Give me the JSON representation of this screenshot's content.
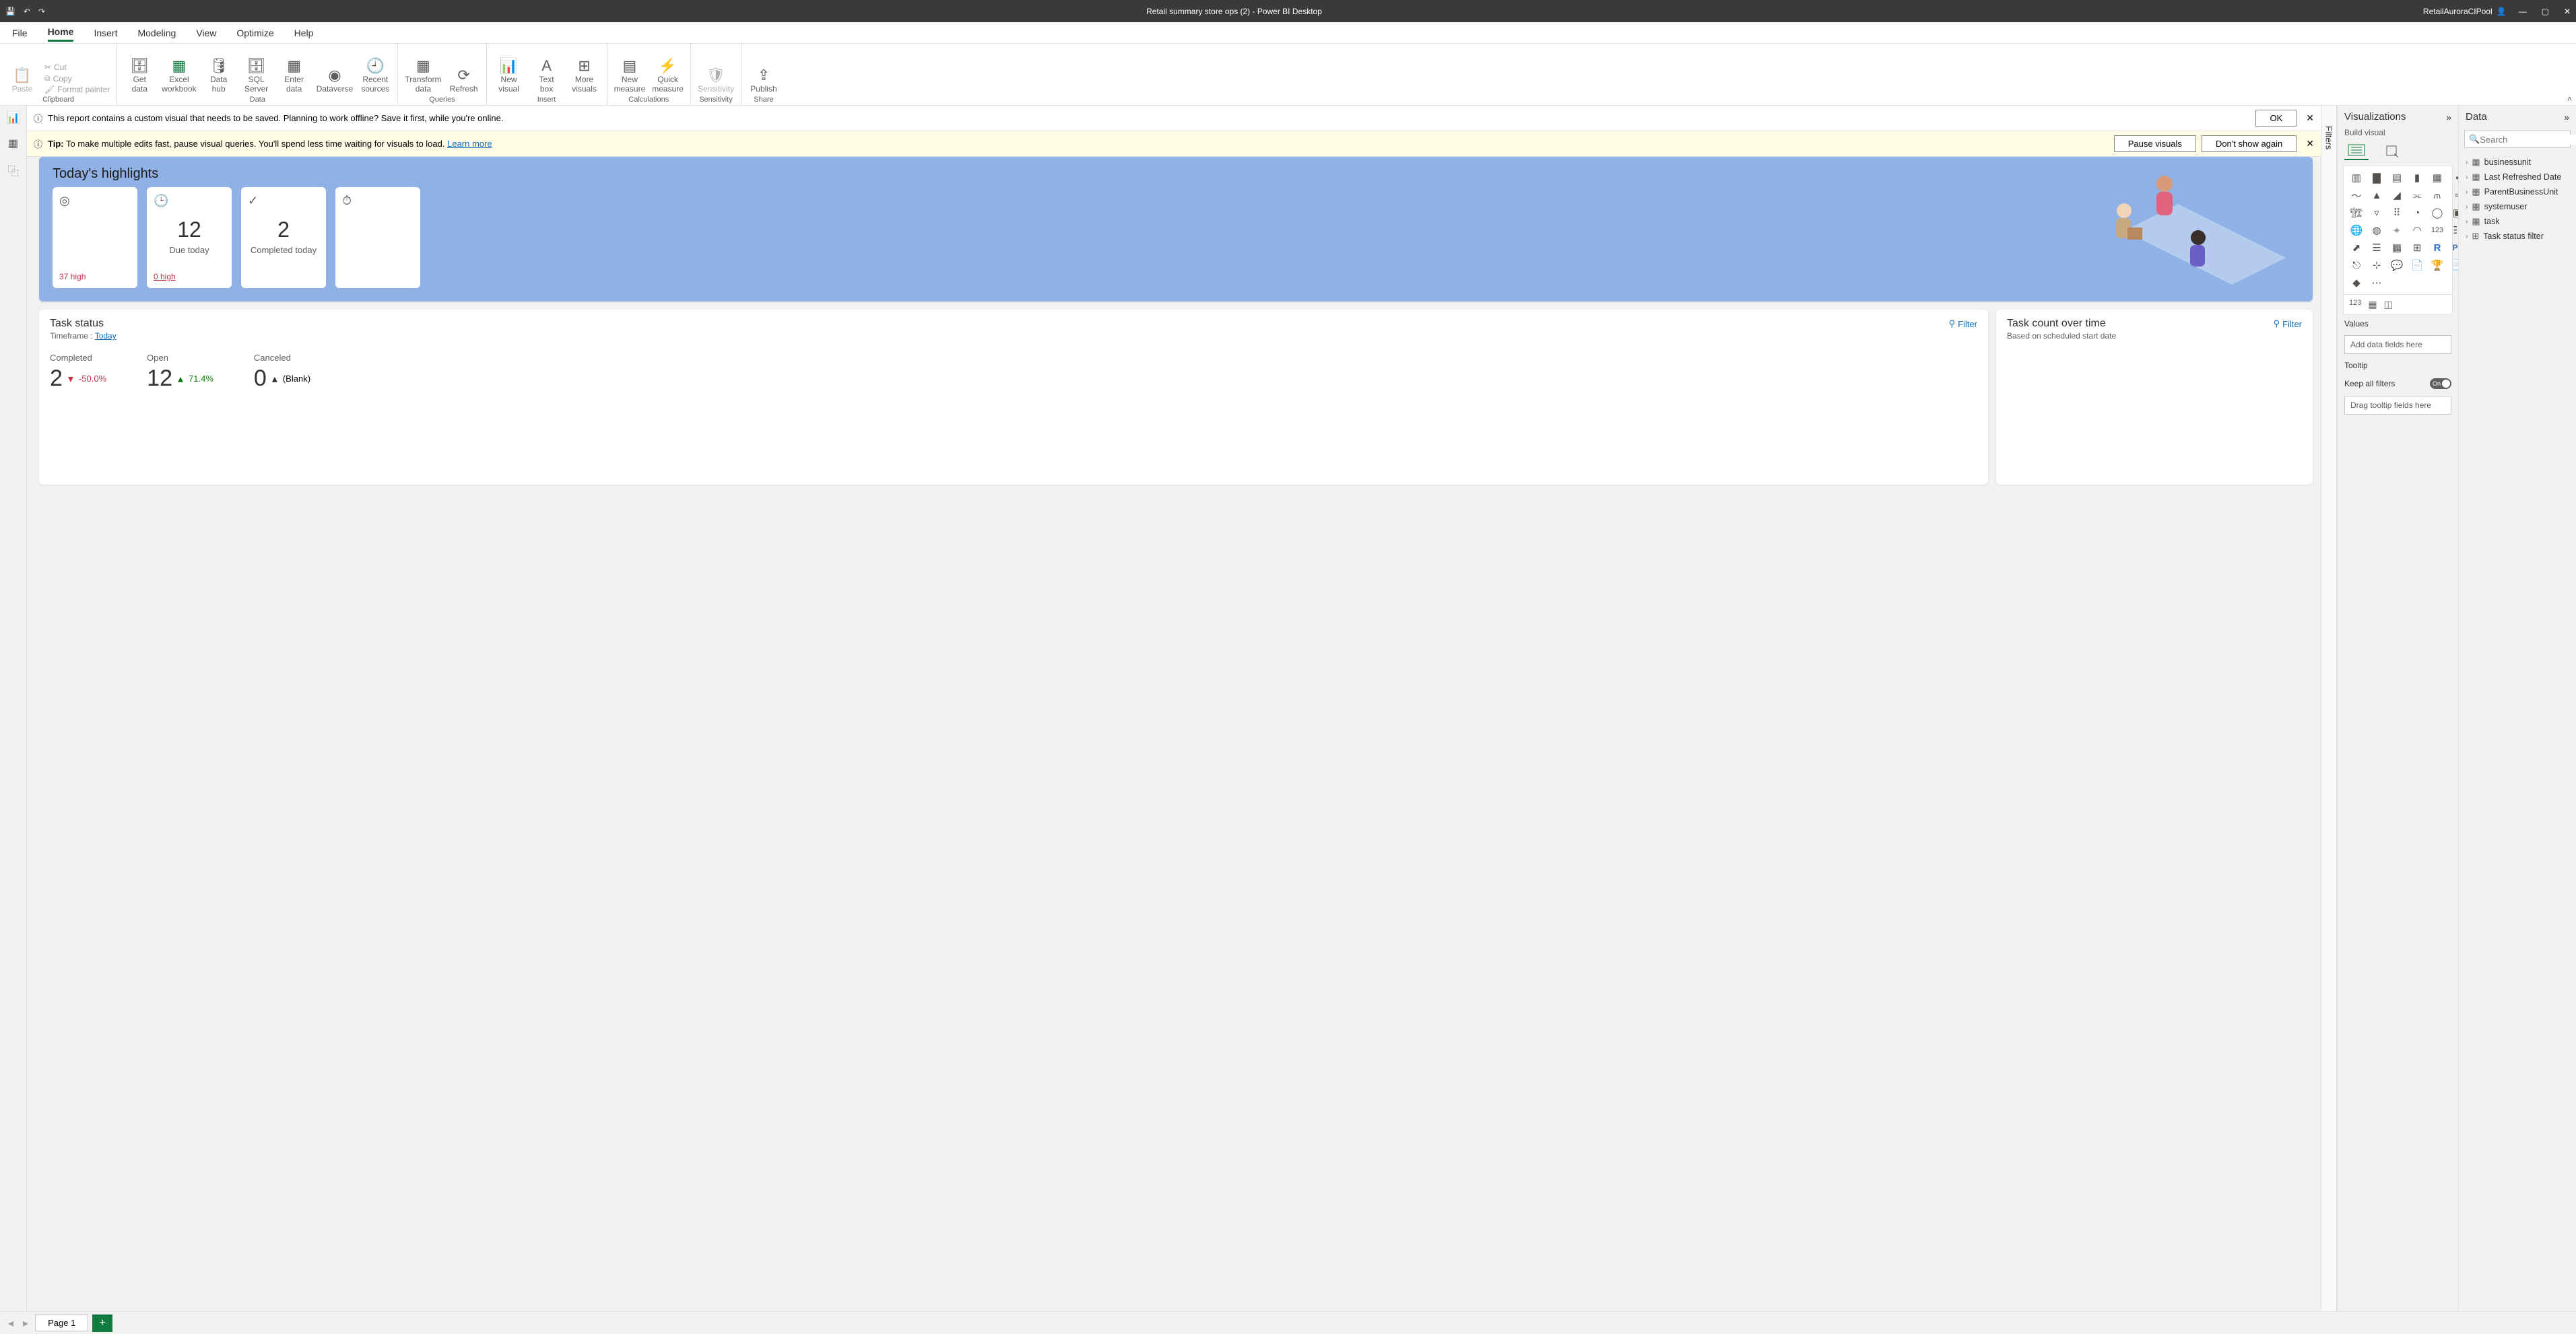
{
  "title": "Retail summary store ops (2) - Power BI Desktop",
  "account": "RetailAuroraCIPool",
  "menus": [
    "File",
    "Home",
    "Insert",
    "Modeling",
    "View",
    "Optimize",
    "Help"
  ],
  "active_menu": "Home",
  "ribbon": {
    "clipboard": {
      "paste": "Paste",
      "cut": "Cut",
      "copy": "Copy",
      "fmt": "Format painter",
      "label": "Clipboard"
    },
    "data": {
      "items": [
        "Get\ndata",
        "Excel\nworkbook",
        "Data\nhub",
        "SQL\nServer",
        "Enter\ndata",
        "Dataverse",
        "Recent\nsources"
      ],
      "label": "Data"
    },
    "queries": {
      "items": [
        "Transform\ndata",
        "Refresh"
      ],
      "label": "Queries"
    },
    "insert": {
      "items": [
        "New\nvisual",
        "Text\nbox",
        "More\nvisuals"
      ],
      "label": "Insert"
    },
    "calc": {
      "items": [
        "New\nmeasure",
        "Quick\nmeasure"
      ],
      "label": "Calculations"
    },
    "sens": {
      "item": "Sensitivity",
      "label": "Sensitivity"
    },
    "share": {
      "item": "Publish",
      "label": "Share"
    }
  },
  "banner1": {
    "text": "This report contains a custom visual that needs to be saved. Planning to work offline? Save it first, while you're online.",
    "ok": "OK"
  },
  "banner2": {
    "tip": "Tip:",
    "text": " To make multiple edits fast, pause visual queries. You'll spend less time waiting for visuals to load.  ",
    "learn": "Learn more",
    "pause": "Pause visuals",
    "dont": "Don't show again"
  },
  "filters_label": "Filters",
  "page_tab": "Page 1",
  "hero": {
    "title": "Today's highlights",
    "cards": [
      {
        "icon": "◎",
        "big": "",
        "lab": "",
        "foot": "37 high"
      },
      {
        "icon": "🕒",
        "big": "12",
        "lab": "Due today",
        "foot": "0 high"
      },
      {
        "icon": "✓",
        "big": "2",
        "lab": "Completed today",
        "foot": ""
      },
      {
        "icon": "⏱",
        "big": "",
        "lab": "",
        "foot": ""
      }
    ]
  },
  "tile1": {
    "title": "Task status",
    "timeframe_label": "Timeframe : ",
    "timeframe_value": "Today",
    "filter": "Filter",
    "stats": [
      {
        "h": "Completed",
        "v": "2",
        "delta": "-50.0%",
        "dir": "down"
      },
      {
        "h": "Open",
        "v": "12",
        "delta": "71.4%",
        "dir": "up"
      },
      {
        "h": "Canceled",
        "v": "0",
        "delta": "(Blank)",
        "dir": "up"
      }
    ]
  },
  "tile2": {
    "title": "Task count over time",
    "sub": "Based on scheduled start date",
    "filter": "Filter"
  },
  "viz_pane": {
    "title": "Visualizations",
    "build": "Build visual",
    "values": "Values",
    "values_well": "Add data fields here",
    "tooltip": "Tooltip",
    "keep": "Keep all filters",
    "toggle": "On",
    "tooltip_well": "Drag tooltip fields here"
  },
  "data_pane": {
    "title": "Data",
    "search": "Search",
    "tables": [
      "businessunit",
      "Last Refreshed Date",
      "ParentBusinessUnit",
      "systemuser",
      "task",
      "Task status filter"
    ]
  }
}
